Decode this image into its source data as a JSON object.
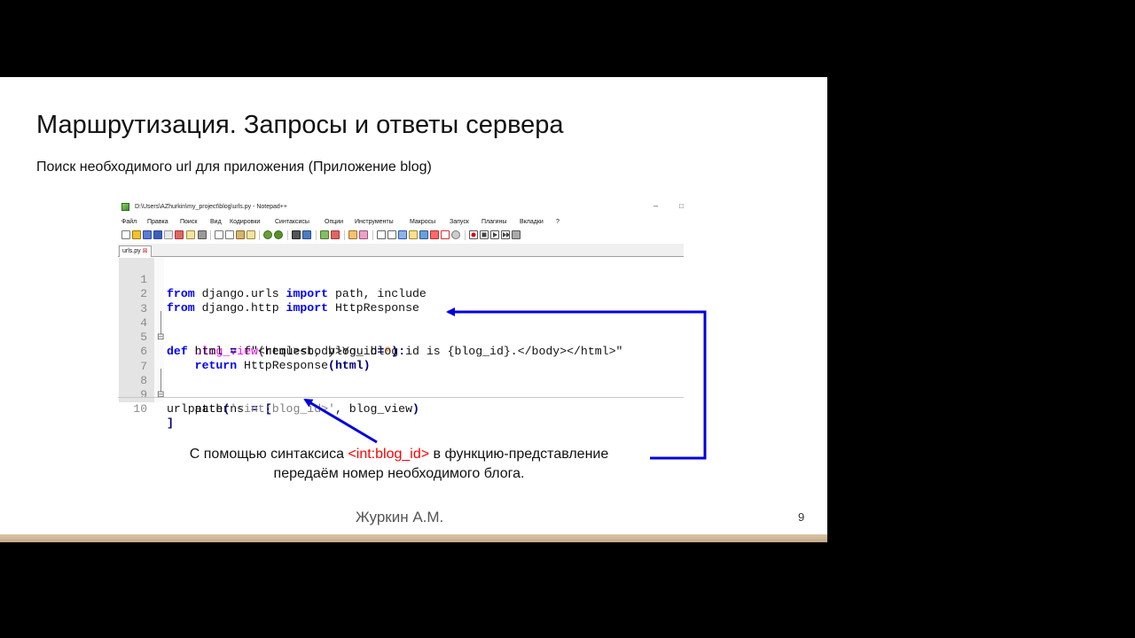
{
  "slide": {
    "title": "Маршрутизация. Запросы и ответы сервера",
    "subtitle": "Поиск необходимого url для приложения (Приложение blog)",
    "callout_before": "С помощью синтаксиса ",
    "callout_highlight": "<int:blog_id>",
    "callout_after": " в функцию-представление",
    "callout_line2": "передаём номер необходимого блога.",
    "author": "Журкин А.М.",
    "page_number": "9"
  },
  "notepad": {
    "title": "D:\\Users\\AZhurkin\\my_project\\blog\\urls.py - Notepad++",
    "window_controls": {
      "minimize": "–",
      "maximize": "□"
    },
    "menu": [
      "Файл",
      "Правка",
      "Поиск",
      "Вид",
      "Кодировки",
      "Синтаксисы",
      "Опции",
      "Инструменты",
      "Макросы",
      "Запуск",
      "Плагины",
      "Вкладки",
      "?"
    ],
    "tab": {
      "label": "urls.py",
      "close": "⊠"
    },
    "line_numbers": [
      "1",
      "2",
      "3",
      "4",
      "5",
      "6",
      "7",
      "8",
      "9",
      "10"
    ],
    "code": {
      "l1": {
        "kw1": "from",
        "mod": " django.urls ",
        "kw2": "import",
        "names": " path, include"
      },
      "l2": {
        "kw1": "from",
        "mod": " django.http ",
        "kw2": "import",
        "names": " HttpResponse"
      },
      "l4": {
        "kw": "def",
        "sp": " ",
        "fname": "blog_view",
        "p1": "(request, blog_id",
        "eq": "=",
        "zero": "0",
        "p2": "):"
      },
      "l5": {
        "indent": "    ",
        "a": "html ",
        "eq": "=",
        "b": " f",
        "s": "\"<html><body>You blog id is {blog_id}.</body></html>\""
      },
      "l6": {
        "indent": "    ",
        "kw": "return",
        "rest": " HttpResponse",
        "p": "(html)"
      },
      "l8": {
        "a": "urlpatterns ",
        "eq": "=",
        "sp": " ",
        "br": "["
      },
      "l9": {
        "indent": "    ",
        "a": "path",
        "p1": "(",
        "s": "'<int:blog_id>'",
        "rest": ", blog_view",
        "p2": ")"
      },
      "l10": {
        "br": "]"
      }
    }
  },
  "colors": {
    "keyword": "#0000ff",
    "function_name": "#ff00ff",
    "number": "#ff8000",
    "string": "#808080",
    "highlight": "#ff0000",
    "arrow": "#0000dd"
  }
}
